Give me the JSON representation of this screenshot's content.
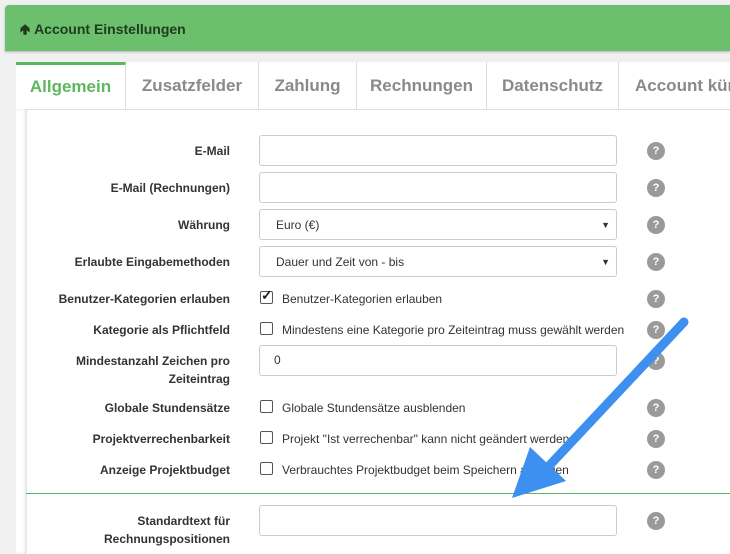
{
  "header": {
    "title": "Account Einstellungen"
  },
  "tabs": [
    "Allgemein",
    "Zusatzfelder",
    "Zahlung",
    "Rechnungen",
    "Datenschutz",
    "Account kün"
  ],
  "form": {
    "email_label": "E-Mail",
    "email_value": "",
    "email_rech_label": "E-Mail (Rechnungen)",
    "email_rech_value": "",
    "currency_label": "Währung",
    "currency_value": "Euro (€)",
    "input_methods_label": "Erlaubte Eingabemethoden",
    "input_methods_value": "Dauer und Zeit von - bis",
    "user_categories_label": "Benutzer-Kategorien erlauben",
    "user_categories_text": "Benutzer-Kategorien erlauben",
    "user_categories_checked": true,
    "category_required_label": "Kategorie als Pflichtfeld",
    "category_required_text": "Mindestens eine Kategorie pro Zeiteintrag muss gewählt werden",
    "category_required_checked": false,
    "min_chars_label_1": "Mindestanzahl Zeichen pro",
    "min_chars_label_2": "Zeiteintrag",
    "min_chars_value": "0",
    "hourly_rates_label": "Globale Stundensätze",
    "hourly_rates_text": "Globale Stundensätze ausblenden",
    "hourly_rates_checked": false,
    "billability_label": "Projektverrechenbarkeit",
    "billability_text": "Projekt \"Ist verrechenbar\" kann nicht geändert werden",
    "billability_checked": false,
    "budget_label": "Anzeige Projektbudget",
    "budget_text": "Verbrauchtes Projektbudget beim Speichern anzeigen",
    "budget_checked": false,
    "default_text_label_1": "Standardtext für",
    "default_text_label_2": "Rechnungspositionen",
    "default_text_value": ""
  },
  "help_symbol": "?",
  "colors": {
    "header_bg": "#6cbf6c",
    "accent": "#5cb85c",
    "annotation_arrow": "#3d8ff0"
  }
}
